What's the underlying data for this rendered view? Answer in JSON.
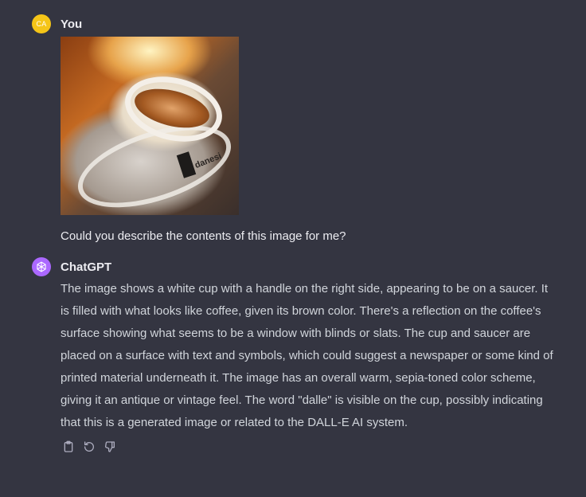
{
  "conversation": {
    "user": {
      "avatar_initials": "CA",
      "name": "You",
      "image_brand": "danesi",
      "message": "Could you describe the contents of this image for me?"
    },
    "assistant": {
      "name": "ChatGPT",
      "message": "The image shows a white cup with a handle on the right side, appearing to be on a saucer. It is filled with what looks like coffee, given its brown color. There's a reflection on the coffee's surface showing what seems to be a window with blinds or slats. The cup and saucer are placed on a surface with text and symbols, which could suggest a newspaper or some kind of printed material underneath it. The image has an overall warm, sepia-toned color scheme, giving it an antique or vintage feel. The word \"dalle\" is visible on the cup, possibly indicating that this is a generated image or related to the DALL-E AI system."
    }
  },
  "actions": [
    {
      "icon": "clipboard-icon"
    },
    {
      "icon": "regenerate-icon"
    },
    {
      "icon": "thumbs-down-icon"
    }
  ],
  "colors": {
    "background": "#343541",
    "user_avatar": "#f5c518",
    "assistant_avatar": "#ab68ff",
    "text_primary": "#ececf1",
    "text_secondary": "#d1d5db",
    "icon": "#acacbe"
  }
}
